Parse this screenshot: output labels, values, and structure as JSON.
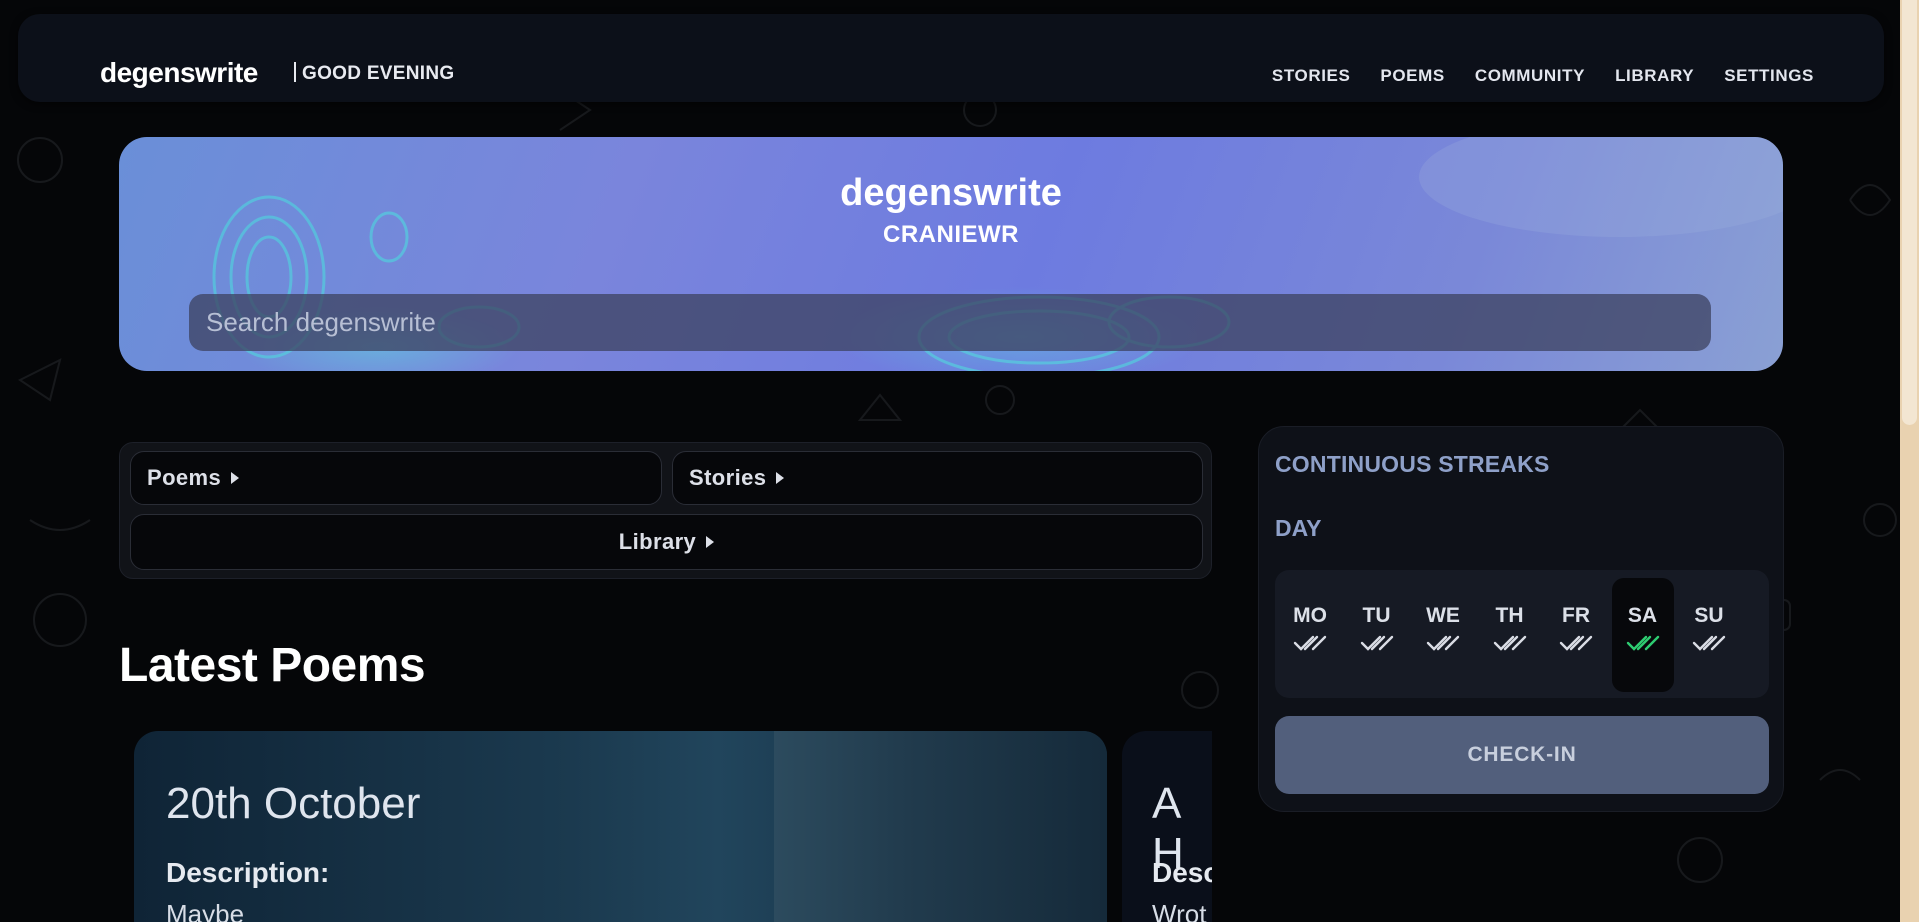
{
  "header": {
    "brand": "degenswrite",
    "greeting": "GOOD EVENING",
    "nav": [
      "STORIES",
      "POEMS",
      "COMMUNITY",
      "LIBRARY",
      "SETTINGS"
    ]
  },
  "hero": {
    "title": "degenswrite",
    "username": "CRANIEWR",
    "search_placeholder": "Search degenswrite"
  },
  "categories": {
    "poems": "Poems",
    "stories": "Stories",
    "library": "Library"
  },
  "latest": {
    "title": "Latest Poems",
    "cards": [
      {
        "title": "20th October",
        "label": "Description:",
        "desc": "Maybe"
      },
      {
        "title": "A H",
        "label": "Desc",
        "desc": "Wrot"
      }
    ]
  },
  "streaks": {
    "title": "CONTINUOUS STREAKS",
    "period": "DAY",
    "days": [
      "MO",
      "TU",
      "WE",
      "TH",
      "FR",
      "SA",
      "SU"
    ],
    "active_day": "SA",
    "checkin_label": "CHECK-IN",
    "check_color": "#d9dce4",
    "active_check_color": "#2ecc71"
  },
  "colors": {
    "background": "#050608",
    "accent": "#8ea0c8",
    "hero_gradient": "#7a85dc"
  }
}
